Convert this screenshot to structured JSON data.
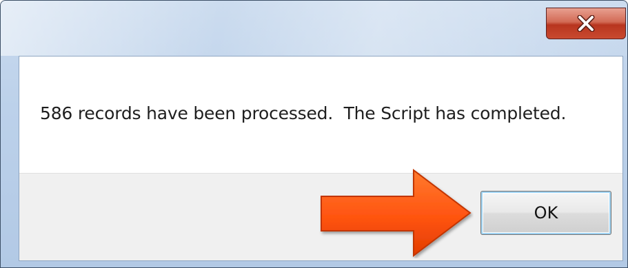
{
  "dialog": {
    "message": "586 records have been processed.  The Script has completed.",
    "ok_label": "OK",
    "close_icon": "close-x-icon",
    "arrow_icon": "orange-arrow-icon"
  },
  "colors": {
    "arrow_fill": "#ff5a1a",
    "close_button": "#c94a30",
    "button_bar": "#f0f0f0"
  }
}
